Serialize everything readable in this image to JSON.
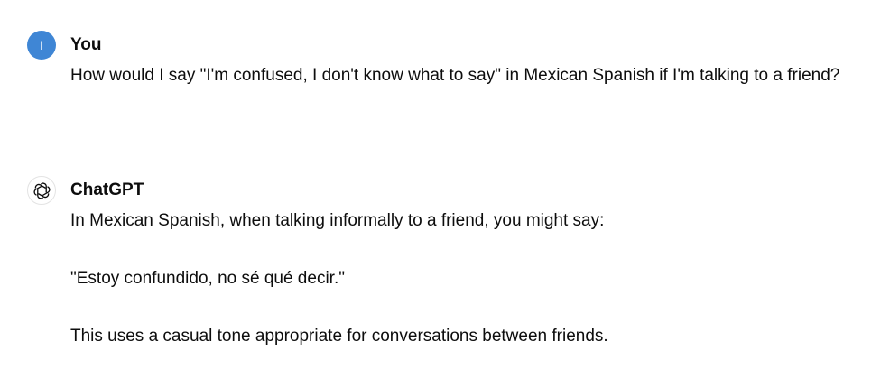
{
  "conversation": {
    "user": {
      "avatar_letter": "I",
      "avatar_color": "#3f86d5",
      "author": "You",
      "text": "How would I say \"I'm confused, I don't know what to say\" in Mexican Spanish if I'm talking to a friend?"
    },
    "assistant": {
      "avatar_icon": "openai-logo-icon",
      "author": "ChatGPT",
      "paragraphs": [
        "In Mexican Spanish, when talking informally to a friend, you might say:",
        "\"Estoy confundido, no sé qué decir.\"",
        "This uses a casual tone appropriate for conversations between friends."
      ]
    }
  }
}
